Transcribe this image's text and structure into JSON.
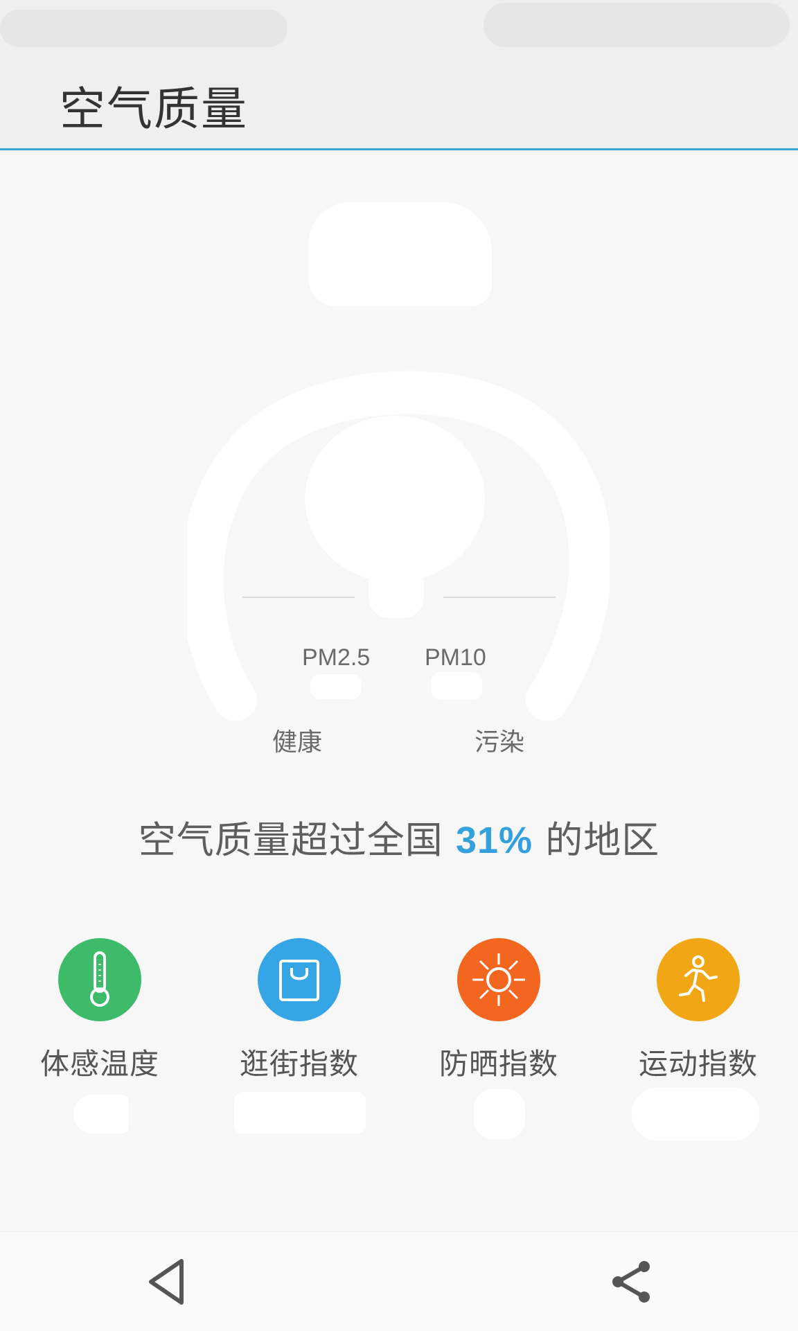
{
  "app_title": "空气质量",
  "gauge": {
    "pm25_label": "PM2.5",
    "pm10_label": "PM10",
    "scale_left": "健康",
    "scale_right": "污染"
  },
  "comparison": {
    "prefix": "空气质量超过全国 ",
    "percent": "31%",
    "suffix": " 的地区"
  },
  "indices": [
    {
      "label": "体感温度",
      "icon": "thermometer-icon",
      "color": "#3dbb6a"
    },
    {
      "label": "逛街指数",
      "icon": "shopping-bag-icon",
      "color": "#36a5e6"
    },
    {
      "label": "防晒指数",
      "icon": "sun-icon",
      "color": "#f2661f"
    },
    {
      "label": "运动指数",
      "icon": "running-person-icon",
      "color": "#f0a615"
    }
  ],
  "colors": {
    "accent": "#3aa0d8",
    "percent_highlight": "#34a0dc"
  },
  "nav": {
    "back_icon": "back-triangle-icon",
    "share_icon": "share-icon"
  }
}
